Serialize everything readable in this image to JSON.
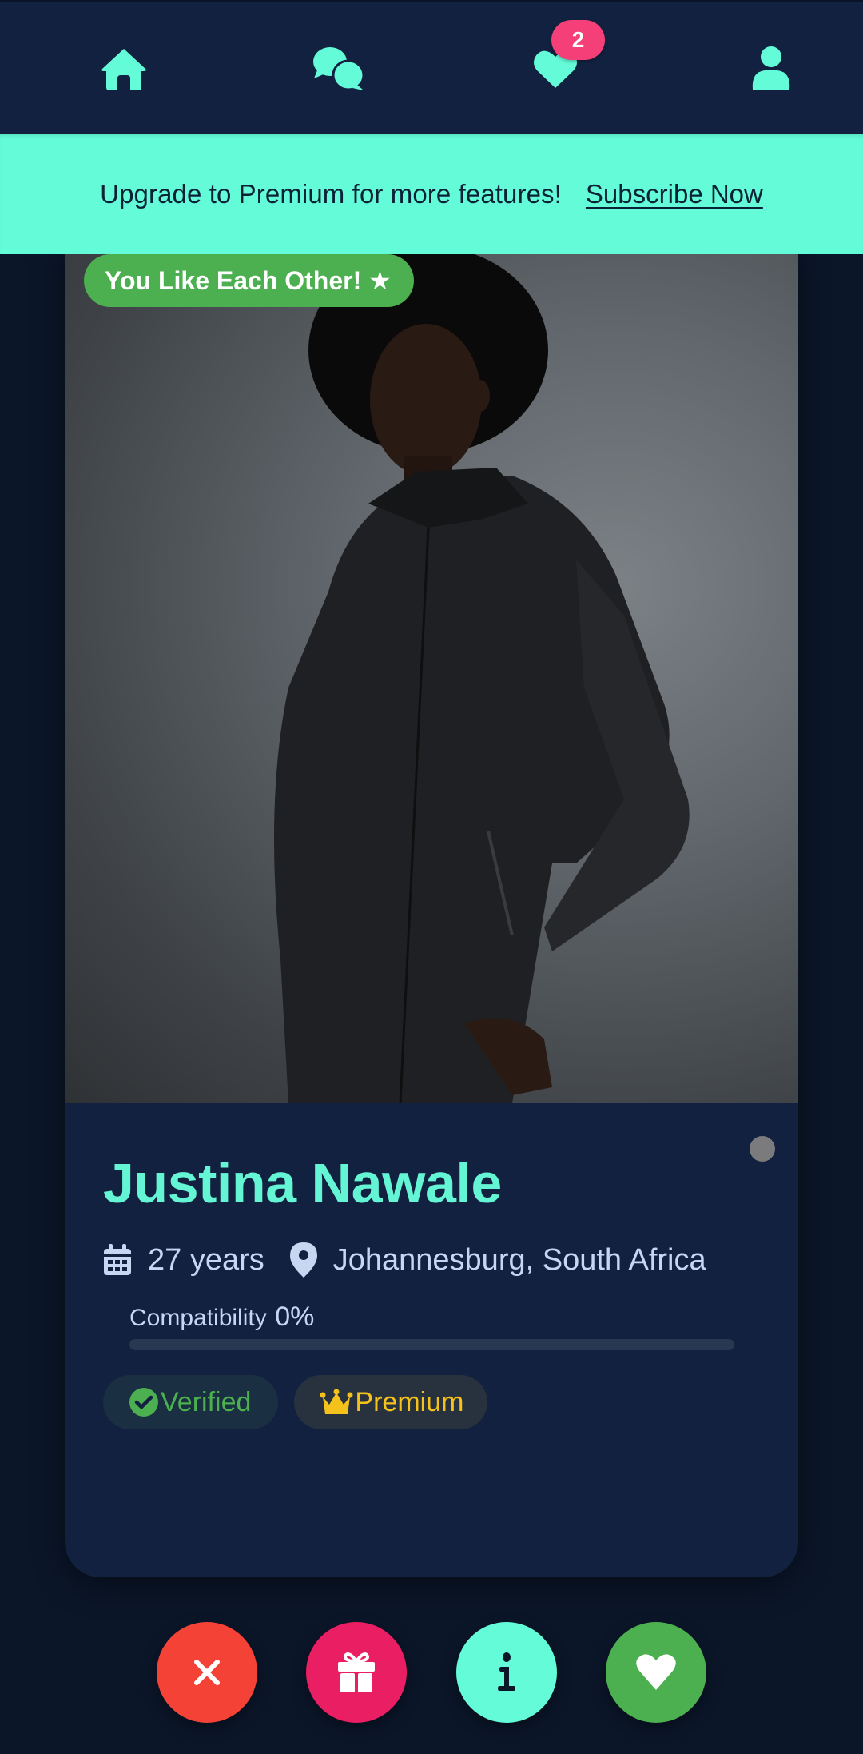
{
  "nav": {
    "items": [
      {
        "name": "home",
        "icon": "home-icon"
      },
      {
        "name": "messages",
        "icon": "chat-bubbles-icon"
      },
      {
        "name": "likes",
        "icon": "heart-icon",
        "badge": "2"
      },
      {
        "name": "profile",
        "icon": "user-icon"
      }
    ],
    "likes_badge": "2"
  },
  "banner": {
    "text": "Upgrade to Premium for more features!",
    "link_label": "Subscribe Now"
  },
  "profile": {
    "match_label": "You Like Each Other! ★",
    "name": "Justina Nawale",
    "age": "27 years",
    "location": "Johannesburg, South Africa",
    "compatibility_label": "Compatibility",
    "compatibility_value": "0%",
    "compatibility_fraction": 0,
    "online_status": "offline",
    "tags": [
      {
        "label": "Verified",
        "icon": "check-circle-icon",
        "color": "#4caf50"
      },
      {
        "label": "Premium",
        "icon": "crown-icon",
        "color": "#f5c21b"
      }
    ],
    "photo_alt": "Woman with afro hair wearing a black zip-up jacket against a grey studio background"
  },
  "actions": [
    {
      "name": "pass",
      "icon": "close-icon",
      "color": "#f44336"
    },
    {
      "name": "gift",
      "icon": "gift-icon",
      "color": "#e91e63"
    },
    {
      "name": "info",
      "icon": "info-icon",
      "color": "#64fcd8"
    },
    {
      "name": "like",
      "icon": "heart-icon",
      "color": "#4caf50"
    }
  ],
  "colors": {
    "accent": "#64fcd8",
    "background": "#0b1629",
    "card": "#122140",
    "badge": "#f43f78"
  }
}
